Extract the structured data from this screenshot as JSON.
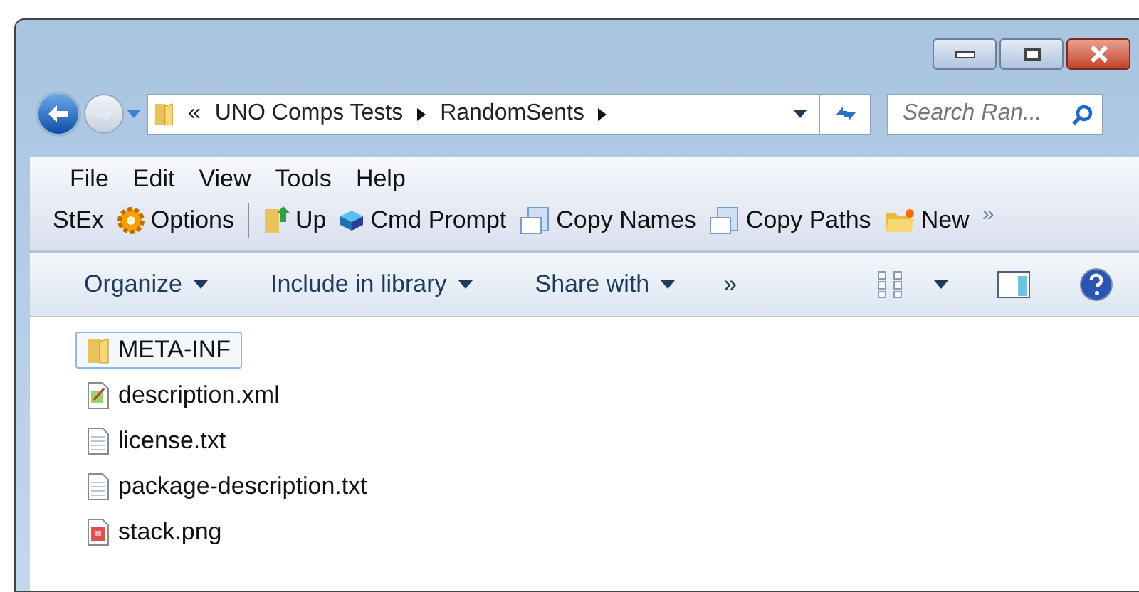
{
  "address": {
    "overflow": "«",
    "crumbs": [
      "UNO Comps Tests",
      "RandomSents"
    ]
  },
  "search": {
    "placeholder": "Search Ran..."
  },
  "menu": [
    "File",
    "Edit",
    "View",
    "Tools",
    "Help"
  ],
  "toolbar": {
    "items": [
      {
        "kind": "text",
        "label": "StEx"
      },
      {
        "kind": "gear",
        "label": "Options"
      },
      {
        "kind": "separator"
      },
      {
        "kind": "up",
        "label": "Up"
      },
      {
        "kind": "cube",
        "label": "Cmd Prompt"
      },
      {
        "kind": "names",
        "label": "Copy Names"
      },
      {
        "kind": "paths",
        "label": "Copy Paths"
      },
      {
        "kind": "newfolder",
        "label": "New"
      }
    ],
    "overflow": "»"
  },
  "commands": {
    "items": [
      "Organize",
      "Include in library",
      "Share with"
    ],
    "overflow": "»"
  },
  "files": [
    {
      "kind": "folder",
      "name": "META-INF",
      "selected": true
    },
    {
      "kind": "xml",
      "name": "description.xml",
      "selected": false
    },
    {
      "kind": "txt",
      "name": "license.txt",
      "selected": false
    },
    {
      "kind": "txt",
      "name": "package-description.txt",
      "selected": false
    },
    {
      "kind": "png",
      "name": "stack.png",
      "selected": false
    }
  ]
}
